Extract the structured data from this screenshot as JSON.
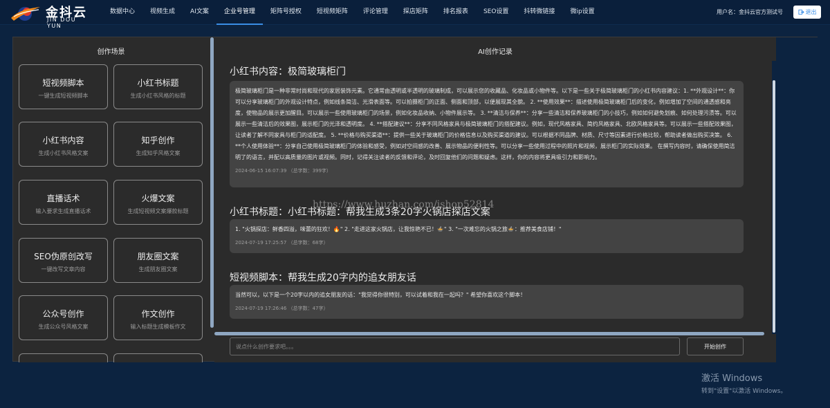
{
  "brand": {
    "name": "金抖云",
    "sub": "JIN DOU YUN"
  },
  "nav": [
    {
      "label": "数据中心",
      "active": false
    },
    {
      "label": "视频生成",
      "active": false
    },
    {
      "label": "AI文案",
      "active": false
    },
    {
      "label": "企业号管理",
      "active": true
    },
    {
      "label": "矩阵号授权",
      "active": false
    },
    {
      "label": "短视频矩阵",
      "active": false
    },
    {
      "label": "评论管理",
      "active": false
    },
    {
      "label": "探店矩阵",
      "active": false
    },
    {
      "label": "排名报表",
      "active": false
    },
    {
      "label": "SEO设置",
      "active": false
    },
    {
      "label": "抖转微链接",
      "active": false
    },
    {
      "label": "微ip设置",
      "active": false
    }
  ],
  "user": {
    "label": "用户名：金抖云官方测试号",
    "logout": "退出"
  },
  "left": {
    "title": "创作场景",
    "cards": [
      {
        "title": "短视频脚本",
        "desc": "一键生成短视频脚本"
      },
      {
        "title": "小红书标题",
        "desc": "生成小红书风格的标题"
      },
      {
        "title": "小红书内容",
        "desc": "生成小红书风格文案"
      },
      {
        "title": "知乎创作",
        "desc": "生成知乎风格文案"
      },
      {
        "title": "直播话术",
        "desc": "输入要求生成直播话术"
      },
      {
        "title": "火爆文案",
        "desc": "生成短视频文案爆款标题"
      },
      {
        "title": "SEO伪原创改写",
        "desc": "一键改写文章内容"
      },
      {
        "title": "朋友圈文案",
        "desc": "生成朋友圈文案"
      },
      {
        "title": "公众号创作",
        "desc": "生成公众号风格文案"
      },
      {
        "title": "作文创作",
        "desc": "输入标题生成模板作文"
      },
      {
        "title": "",
        "desc": ""
      },
      {
        "title": "",
        "desc": ""
      }
    ]
  },
  "right": {
    "title": "AI创作记录",
    "records": [
      {
        "title": "小红书内容：极简玻璃柜门",
        "content": "极简玻璃柜门是一种非常时尚和现代的家居装饰元素。它通常由透明或半透明的玻璃制成，可以展示您的收藏品、化妆品或小物件等。以下是一些关于极简玻璃柜门的小红书内容建议：1. **外观设计**：你可以分享玻璃柜门的外观设计特点，例如线条简洁、光滑表面等。可以拍摄柜门的正面、侧面和顶部，以便展现其全貌。 2. **使用效果**：描述使用极简玻璃柜门后的变化，例如增加了空间的通透感和亮度，使物品的展示更加醒目。可以展示一些使用玻璃柜门的场景，例如化妆品收纳、小物件展示等。 3. **清洁与保养**：分享一些清洁和保养玻璃柜门的小技巧，例如如何避免划痕、如何处理污渍等。可以展示一些清洁后的效果图，展示柜门的光泽和透明度。 4. **搭配建议**：分享不同风格家具与极简玻璃柜门的搭配建议。例如，现代风格家具、简约风格家具、北欧风格家具等。可以展示一些搭配效果图，让读者了解不同家具与柜门的适配度。 5. **价格与购买渠道**：提供一些关于玻璃柜门的价格信息以及购买渠道的建议。可以根据不同品牌、材质、尺寸等因素进行价格比较，帮助读者做出购买决策。 6. **个人使用体验**：分享自己使用极简玻璃柜门的体验和感受，例如对空间感的改善、展示物品的便利性等。可以分享一些使用过程中的照片和视频，展示柜门的实际效果。 在撰写内容时，请确保使用简洁明了的语言，并配以高质量的图片或视频。同时，记得关注读者的反馈和评论，及时回复他们的问题和疑虑。这样，你的内容将更具吸引力和影响力。",
        "meta": "2024-06-15 16:07:39 （总字数：399字）"
      },
      {
        "title": "小红书标题：小红书标题：帮我生成3条20字火锅店探店文案",
        "content": "1. \"火锅探店：鲜香四溢，味蕾的狂欢！🔥\" 2. \"走进这家火锅店，让我惊艳不已！🍲\" 3. \"一次难忘的火锅之旅🍲：推荐美食店铺！\"",
        "meta": "2024-07-19 17:25:57 （总字数：68字）"
      },
      {
        "title": "短视频脚本：帮我生成20字内的追女朋友话",
        "content": "当然可以，以下是一个20字以内的追女朋友的话：\"我觉得你很特别，可以试着和我在一起吗？\" 希望你喜欢这个脚本！",
        "meta": "2024-07-19 17:26:46 （总字数：47字）"
      }
    ],
    "input_placeholder": "说点什么创作要求吧。。。",
    "start_label": "开始创作"
  },
  "watermark": "https://www.huzhan.com/ishop52814",
  "windows": {
    "title": "激活 Windows",
    "sub": "转到\"设置\"以激活 Windows。"
  },
  "colors": {
    "page_bg": "#0c2340",
    "topbar_bg": "#0a1f3b",
    "panel_bg": "#2b2b2b",
    "record_bg": "#434343",
    "accent": "#3a8ee6"
  }
}
